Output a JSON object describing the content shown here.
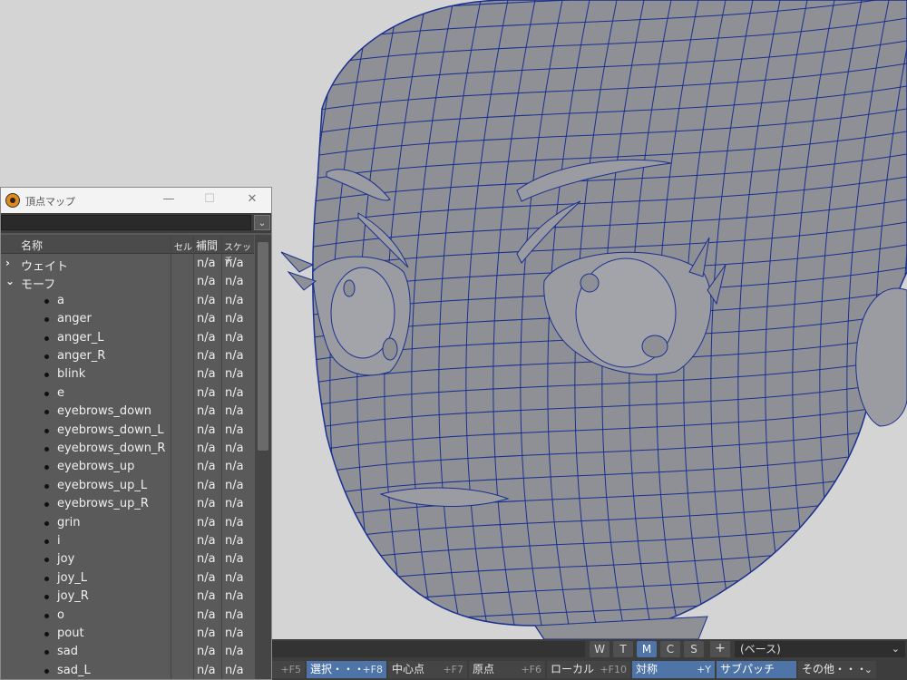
{
  "window": {
    "title": "頂点マップ",
    "minimize": "—",
    "maximize": "☐",
    "close": "✕"
  },
  "filter": {
    "value": "",
    "dropdown_glyph": "⌄"
  },
  "columns": {
    "name": "名称",
    "cell": "セル",
    "interp": "補間",
    "sketch": "スケッチ"
  },
  "rows": [
    {
      "type": "group",
      "expanded": false,
      "name": "ウェイト",
      "interp": "n/a",
      "sketch": "n/a"
    },
    {
      "type": "group",
      "expanded": true,
      "name": "モーフ",
      "interp": "n/a",
      "sketch": "n/a"
    },
    {
      "type": "item",
      "name": "a",
      "interp": "n/a",
      "sketch": "n/a"
    },
    {
      "type": "item",
      "name": "anger",
      "interp": "n/a",
      "sketch": "n/a"
    },
    {
      "type": "item",
      "name": "anger_L",
      "interp": "n/a",
      "sketch": "n/a"
    },
    {
      "type": "item",
      "name": "anger_R",
      "interp": "n/a",
      "sketch": "n/a"
    },
    {
      "type": "item",
      "name": "blink",
      "interp": "n/a",
      "sketch": "n/a"
    },
    {
      "type": "item",
      "name": "e",
      "interp": "n/a",
      "sketch": "n/a"
    },
    {
      "type": "item",
      "name": "eyebrows_down",
      "interp": "n/a",
      "sketch": "n/a"
    },
    {
      "type": "item",
      "name": "eyebrows_down_L",
      "interp": "n/a",
      "sketch": "n/a"
    },
    {
      "type": "item",
      "name": "eyebrows_down_R",
      "interp": "n/a",
      "sketch": "n/a"
    },
    {
      "type": "item",
      "name": "eyebrows_up",
      "interp": "n/a",
      "sketch": "n/a"
    },
    {
      "type": "item",
      "name": "eyebrows_up_L",
      "interp": "n/a",
      "sketch": "n/a"
    },
    {
      "type": "item",
      "name": "eyebrows_up_R",
      "interp": "n/a",
      "sketch": "n/a"
    },
    {
      "type": "item",
      "name": "grin",
      "interp": "n/a",
      "sketch": "n/a"
    },
    {
      "type": "item",
      "name": "i",
      "interp": "n/a",
      "sketch": "n/a"
    },
    {
      "type": "item",
      "name": "joy",
      "interp": "n/a",
      "sketch": "n/a"
    },
    {
      "type": "item",
      "name": "joy_L",
      "interp": "n/a",
      "sketch": "n/a"
    },
    {
      "type": "item",
      "name": "joy_R",
      "interp": "n/a",
      "sketch": "n/a"
    },
    {
      "type": "item",
      "name": "o",
      "interp": "n/a",
      "sketch": "n/a"
    },
    {
      "type": "item",
      "name": "pout",
      "interp": "n/a",
      "sketch": "n/a"
    },
    {
      "type": "item",
      "name": "sad",
      "interp": "n/a",
      "sketch": "n/a"
    },
    {
      "type": "item",
      "name": "sad_L",
      "interp": "n/a",
      "sketch": "n/a"
    }
  ],
  "toolbar": {
    "modes": [
      {
        "label": "W",
        "active": false
      },
      {
        "label": "T",
        "active": false
      },
      {
        "label": "M",
        "active": true
      },
      {
        "label": "C",
        "active": false
      },
      {
        "label": "S",
        "active": false
      }
    ],
    "plus": "+",
    "layer": "(ベース)",
    "buttons": [
      {
        "label": "",
        "key": "+F5",
        "active": false
      },
      {
        "label": "選択・・・",
        "key": "+F8",
        "active": true
      },
      {
        "label": "中心点",
        "key": "+F7",
        "active": false
      },
      {
        "label": "原点",
        "key": "+F6",
        "active": false
      },
      {
        "label": "ローカル",
        "key": "+F10",
        "active": false
      },
      {
        "label": "対称",
        "key": "+Y",
        "active": true
      },
      {
        "label": "サブパッチ",
        "key": "",
        "active": true
      },
      {
        "label": "その他・・・",
        "key": "",
        "active": false
      }
    ]
  },
  "colors": {
    "mesh_fill": "#8e9096",
    "wire": "#1a2f8f",
    "accent": "#4e74a8",
    "panel": "#5a5a5a"
  }
}
